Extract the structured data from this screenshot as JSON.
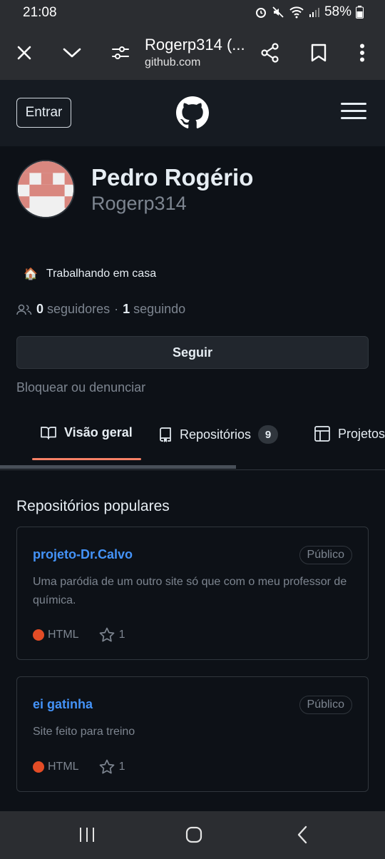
{
  "status_bar": {
    "time": "21:08",
    "battery": "58%"
  },
  "browser": {
    "title": "Rogerp314 (...",
    "url": "github.com",
    "icons": [
      "close-icon",
      "chevron-down-icon",
      "site-settings-icon",
      "share-icon",
      "bookmark-icon",
      "more-vert-icon"
    ]
  },
  "header": {
    "signin_label": "Entrar",
    "logo": "github-mark-icon",
    "menu": "hamburger-icon"
  },
  "profile": {
    "name": "Pedro Rogério",
    "login": "Rogerp314",
    "status_emoji": "🏠",
    "status_text": "Trabalhando em casa",
    "followers_count": "0",
    "followers_label": "seguidores",
    "separator": "·",
    "following_count": "1",
    "following_label": "seguindo",
    "follow_button": "Seguir",
    "block_label": "Bloquear ou denunciar"
  },
  "tabs": [
    {
      "label": "Visão geral",
      "icon": "book-icon",
      "active": true
    },
    {
      "label": "Repositórios",
      "icon": "repo-icon",
      "count": "9"
    },
    {
      "label": "Projetos",
      "icon": "table-icon"
    }
  ],
  "popular": {
    "title": "Repositórios populares",
    "repos": [
      {
        "name": "projeto-Dr.Calvo",
        "visibility": "Público",
        "description": "Uma paródia de um outro site só que com o meu professor de química.",
        "language": "HTML",
        "language_color": "#e34c26",
        "stars": "1"
      },
      {
        "name": "ei gatinha",
        "visibility": "Público",
        "description": "Site feito para treino",
        "language": "HTML",
        "language_color": "#e34c26",
        "stars": "1"
      }
    ]
  },
  "colors": {
    "background": "#0d1117",
    "header": "#161b22",
    "link": "#4493f8",
    "tab_accent": "#f78166",
    "muted": "#7d8590"
  }
}
